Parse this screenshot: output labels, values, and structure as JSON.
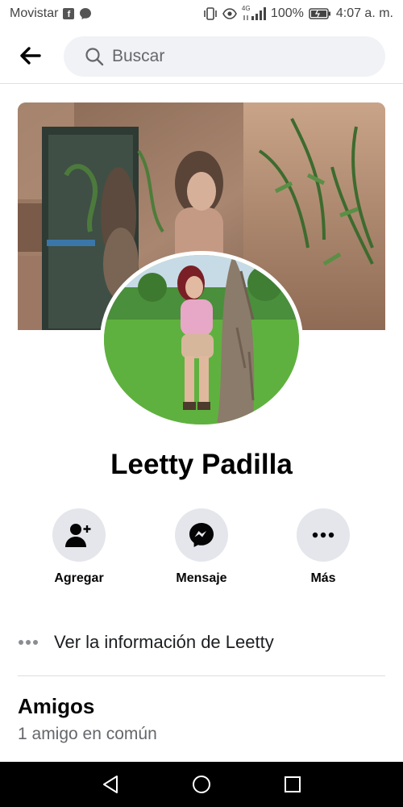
{
  "status_bar": {
    "carrier": "Movistar",
    "network": "4G",
    "battery": "100%",
    "time": "4:07 a. m."
  },
  "search": {
    "placeholder": "Buscar"
  },
  "profile": {
    "name": "Leetty Padilla"
  },
  "actions": [
    {
      "label": "Agregar",
      "icon": "add-friend-icon"
    },
    {
      "label": "Mensaje",
      "icon": "messenger-icon"
    },
    {
      "label": "Más",
      "icon": "more-icon"
    }
  ],
  "info": {
    "label": "Ver la información de Leetty"
  },
  "friends": {
    "title": "Amigos",
    "subtitle": "1 amigo en común"
  },
  "colors": {
    "accent": "#1877f2",
    "button_bg": "#e4e6eb",
    "search_bg": "#f0f2f5",
    "muted_text": "#65676b"
  }
}
